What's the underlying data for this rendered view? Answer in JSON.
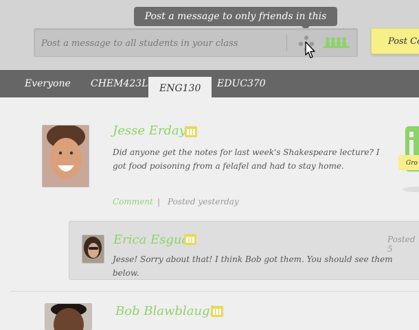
{
  "composer": {
    "placeholder": "Post a message to all students in your class",
    "tooltip": "Post a message to only friends in this course",
    "post_label": "Post Co"
  },
  "tabs": [
    {
      "label": "Everyone",
      "active": false
    },
    {
      "label": "CHEM423L",
      "active": false
    },
    {
      "label": "ENG130",
      "active": true
    },
    {
      "label": "EDUC370",
      "active": false
    }
  ],
  "posts": [
    {
      "author": "Jesse Erday",
      "text": "Did anyone get the notes for last week's Shakespeare lecture?  I got food poisoning from a felafel and had to stay home.",
      "comment_label": "Comment",
      "separator": "|",
      "posted": "Posted yesterday"
    },
    {
      "author": "Bob Blawblaugh"
    }
  ],
  "reply": {
    "author": "Erica Esgua",
    "text": "Jesse!  Sorry about that!  I think Bob got them.  You should see them below.",
    "posted": "Posted 5"
  },
  "side_widget": {
    "label": "Gro"
  },
  "colors": {
    "accent_green": "#8ed26a",
    "tab_bar": "#666666",
    "post_button": "#f7ef8a",
    "badge_yellow": "#e6d95a"
  }
}
